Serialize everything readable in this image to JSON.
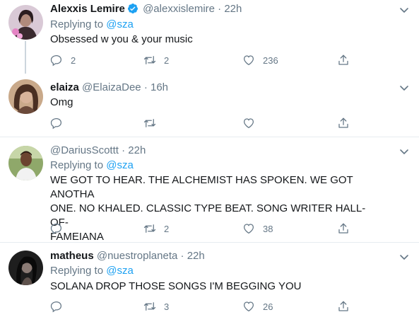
{
  "tweets": [
    {
      "name": "Alexxis Lemire",
      "verified": true,
      "handle": "@alexxislemire",
      "dot": "·",
      "time": "22h",
      "replying_prefix": "Replying to ",
      "replying_mention": "@sza",
      "lines": [
        "Obsessed w you & your music"
      ],
      "replies": "2",
      "retweets": "2",
      "likes": "236"
    },
    {
      "name": "elaiza",
      "verified": false,
      "handle": "@ElaizaDee",
      "dot": "·",
      "time": "16h",
      "lines": [
        "Omg"
      ],
      "replies": "",
      "retweets": "",
      "likes": ""
    },
    {
      "name": "",
      "verified": false,
      "handle": "@DariusScottt",
      "dot": "·",
      "time": "22h",
      "replying_prefix": "Replying to ",
      "replying_mention": "@sza",
      "lines": [
        "WE GOT TO HEAR. THE ALCHEMIST HAS SPOKEN. WE GOT ANOTHA",
        "ONE. NO KHALED. CLASSIC TYPE BEAT. SONG WRITER HALL-OF-",
        "FAMEIANA"
      ],
      "replies": "",
      "retweets": "2",
      "likes": "38"
    },
    {
      "name": "matheus",
      "verified": false,
      "handle": "@nuestroplaneta",
      "dot": "·",
      "time": "22h",
      "replying_prefix": "Replying to ",
      "replying_mention": "@sza",
      "lines": [
        "SOLANA DROP THOSE SONGS I'M BEGGING YOU"
      ],
      "replies": "",
      "retweets": "3",
      "likes": "26"
    }
  ],
  "colors": {
    "accent": "#1da1f2",
    "muted": "#657786",
    "divider": "#e6ecf0"
  },
  "icons": {
    "reply": "reply-icon",
    "retweet": "retweet-icon",
    "like": "like-icon",
    "share": "share-icon",
    "caret": "chevron-down-icon",
    "verified": "verified-badge-icon"
  }
}
